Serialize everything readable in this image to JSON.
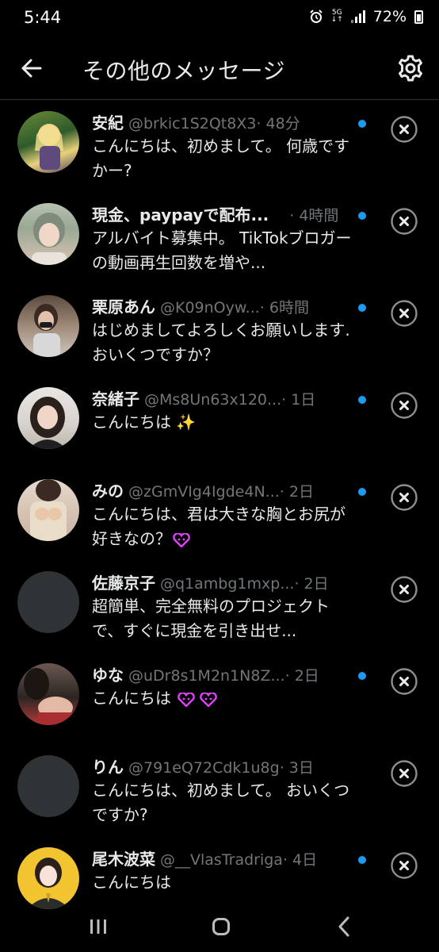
{
  "status_bar": {
    "time": "5:44",
    "network": "5G",
    "battery": "72%"
  },
  "header": {
    "title": "その他のメッセージ"
  },
  "conversations": [
    {
      "name": "安紀",
      "handle": "@brkic1S2Qt8X3",
      "time": "· 48分",
      "message": "こんにちは、初めまして。 何歳ですかー?",
      "avatar": "anime-character",
      "hearts": 0
    },
    {
      "name": "現金、paypayで配布...",
      "handle": "",
      "time": "· 4時間",
      "message": "アルバイト募集中。 TikTokブロガーの動画再生回数を増や...",
      "avatar": "photo",
      "hearts": 0
    },
    {
      "name": "栗原あん",
      "handle": "@K09nOyw...",
      "time": "· 6時間",
      "message": "はじめましてよろしくお願いします.おいくつですか？",
      "avatar": "photo",
      "hearts": 0
    },
    {
      "name": "奈緒子",
      "handle": "@Ms8Un63x120...",
      "time": "· 1日",
      "message": "こんにちは ✨",
      "avatar": "photo",
      "hearts": 0
    },
    {
      "name": "みの",
      "handle": "@zGmVIg4Igde4N...",
      "time": "· 2日",
      "message": "こんにちは、君は大きな胸とお尻が好きなの？",
      "avatar": "photo",
      "hearts": 1
    },
    {
      "name": "佐藤京子",
      "handle": "@q1ambg1mxp...",
      "time": "· 2日",
      "message": "超簡単、完全無料のプロジェクトで、すぐに現金を引き出せ...",
      "avatar": "blank",
      "hearts": 0
    },
    {
      "name": "ゆな",
      "handle": "@uDr8s1M2n1N8Z...",
      "time": "· 2日",
      "message": "こんにちは",
      "avatar": "photo",
      "hearts": 2
    },
    {
      "name": "りん",
      "handle": "@791eQ72Cdk1u8g",
      "time": "· 3日",
      "message": "こんにちは、初めまして。 おいくつですか?",
      "avatar": "blank",
      "hearts": 0
    },
    {
      "name": "尾木波菜",
      "handle": "@__VlasTradriga",
      "time": "· 4日",
      "message": "こんにちは",
      "avatar": "photo",
      "hearts": 0
    }
  ],
  "colors": {
    "background": "#000000",
    "text": "#e7e9ea",
    "secondary": "#71767b",
    "unread_dot": "#1d9bf0",
    "divider": "#2f3336",
    "heart": "#e040fb"
  },
  "icons": [
    "back-arrow-icon",
    "gear-icon",
    "close-circle-icon",
    "alarm-icon",
    "signal-icon",
    "battery-icon",
    "recent-apps-icon",
    "home-icon",
    "back-chevron-icon"
  ]
}
